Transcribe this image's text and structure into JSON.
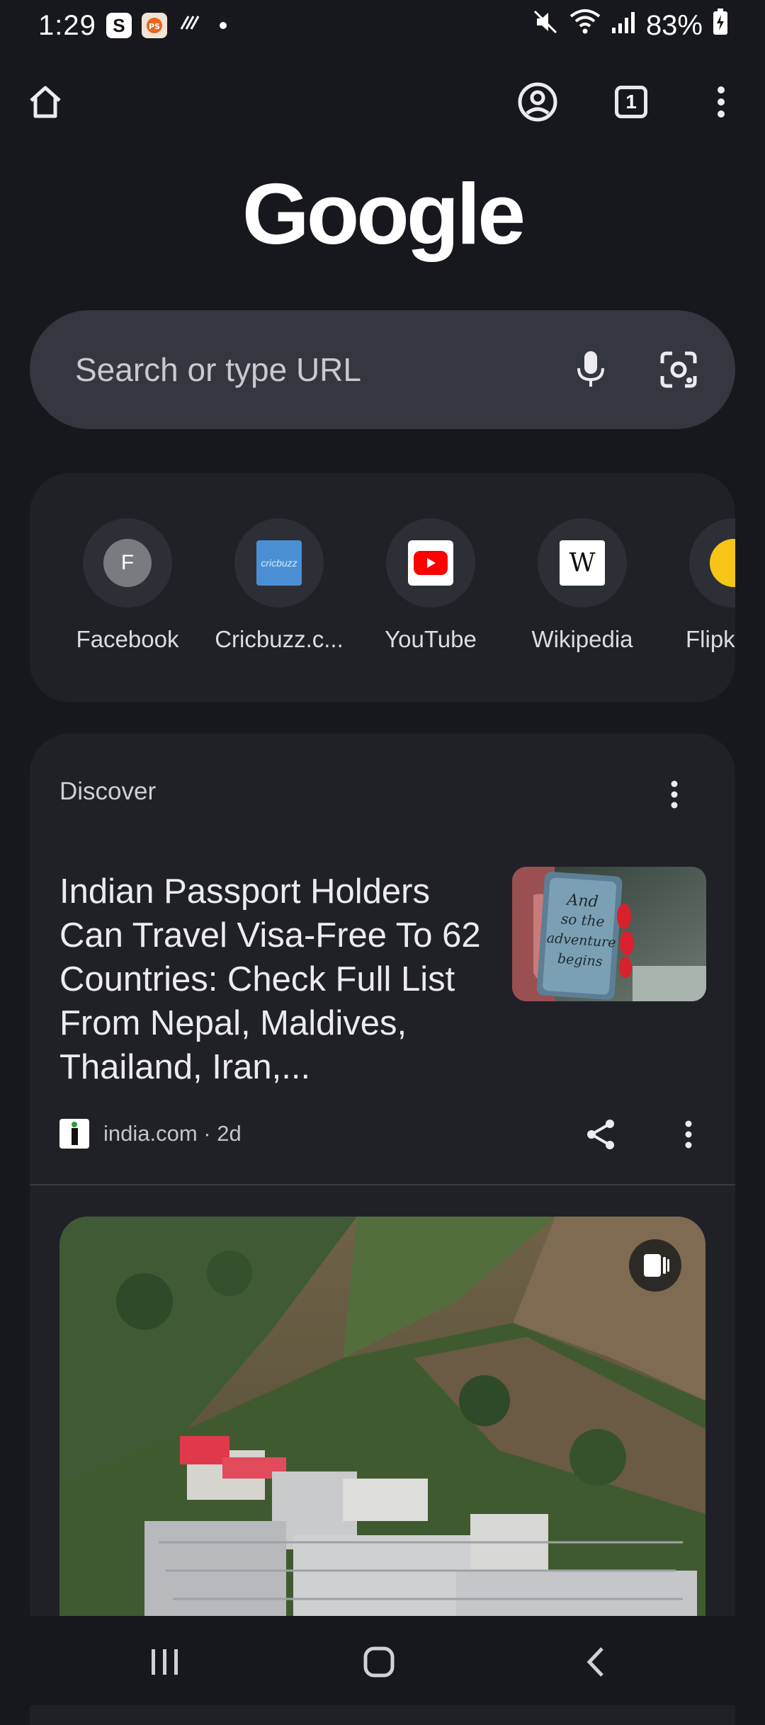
{
  "status_bar": {
    "time": "1:29",
    "notification_icons": [
      "s-app-icon",
      "game-app-icon",
      "stripes-app-icon"
    ],
    "badge_s": "S",
    "battery": "83%",
    "system_icons": [
      "mute-icon",
      "wifi-icon",
      "signal-icon",
      "battery-charging-icon"
    ]
  },
  "toolbar": {
    "tab_count": "1",
    "icons": [
      "home-icon",
      "account-icon",
      "tab-switcher-icon",
      "more-vert-icon"
    ]
  },
  "logo_text": "Google",
  "search": {
    "placeholder": "Search or type URL",
    "icons": [
      "mic-icon",
      "google-lens-icon"
    ]
  },
  "shortcuts": [
    {
      "label": "Facebook",
      "letter": "F"
    },
    {
      "label": "Cricbuzz.c...",
      "icon_text": "cricbuzz"
    },
    {
      "label": "YouTube"
    },
    {
      "label": "Wikipedia",
      "letter": "W"
    },
    {
      "label": "Flipkar"
    }
  ],
  "discover": {
    "title": "Discover",
    "articles": [
      {
        "headline": "Indian Passport Holders Can Travel Visa-Free To 62 Countries: Check Full List From Nepal, Maldives, Thailand, Iran,...",
        "source": "india.com · 2d",
        "thumbnail_text": "And so the adventure begins"
      }
    ]
  },
  "colors": {
    "background": "#17181d",
    "card": "#202127",
    "search_box": "#34373f",
    "text_primary": "#ececf0",
    "text_secondary": "#c4c5ca"
  }
}
